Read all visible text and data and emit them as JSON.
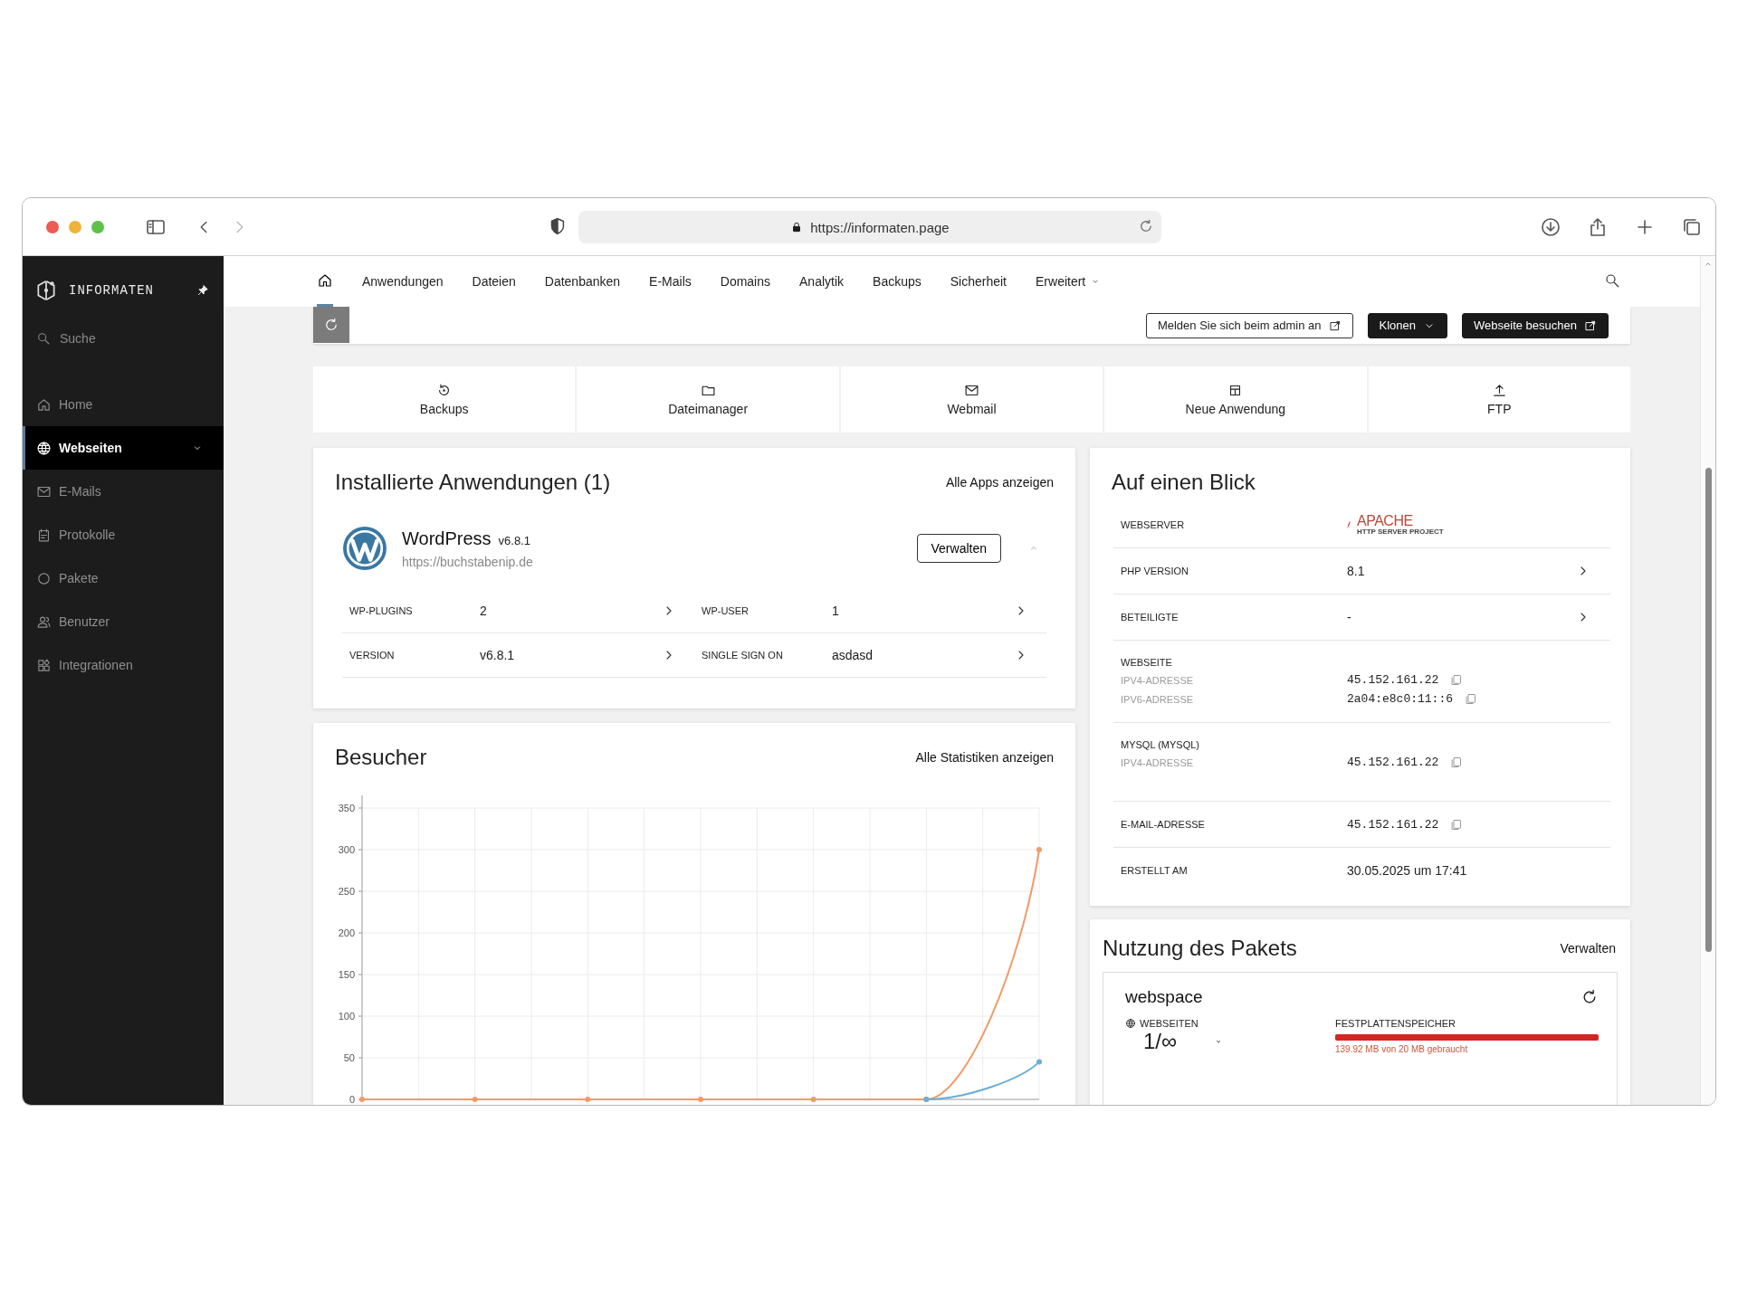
{
  "browser": {
    "url": "https://informaten.page",
    "forward_disabled": true
  },
  "sidebar": {
    "brand": "INFORMATEN",
    "search_placeholder": "Suche",
    "items": [
      {
        "label": "Home",
        "kind": "home",
        "selected": false,
        "expandable": false
      },
      {
        "label": "Webseiten",
        "kind": "globe",
        "selected": true,
        "expandable": true
      },
      {
        "label": "E-Mails",
        "kind": "mail",
        "selected": false,
        "expandable": false
      },
      {
        "label": "Protokolle",
        "kind": "calendar",
        "selected": false,
        "expandable": false
      },
      {
        "label": "Pakete",
        "kind": "circle",
        "selected": false,
        "expandable": false
      },
      {
        "label": "Benutzer",
        "kind": "users",
        "selected": false,
        "expandable": false
      },
      {
        "label": "Integrationen",
        "kind": "grid",
        "selected": false,
        "expandable": false
      }
    ]
  },
  "nav": {
    "items": [
      {
        "kind": "home",
        "selected": true,
        "dropdown": false
      },
      {
        "kind": "text",
        "label": "Anwendungen",
        "selected": false,
        "dropdown": false
      },
      {
        "kind": "text",
        "label": "Dateien",
        "selected": false,
        "dropdown": false
      },
      {
        "kind": "text",
        "label": "Datenbanken",
        "selected": false,
        "dropdown": false
      },
      {
        "kind": "text",
        "label": "E-Mails",
        "selected": false,
        "dropdown": false
      },
      {
        "kind": "text",
        "label": "Domains",
        "selected": false,
        "dropdown": false
      },
      {
        "kind": "text",
        "label": "Analytik",
        "selected": false,
        "dropdown": false
      },
      {
        "kind": "text",
        "label": "Backups",
        "selected": false,
        "dropdown": false
      },
      {
        "kind": "text",
        "label": "Sicherheit",
        "selected": false,
        "dropdown": false
      },
      {
        "kind": "text",
        "label": "Erweitert",
        "selected": false,
        "dropdown": true
      }
    ]
  },
  "actions": [
    {
      "label": "Melden Sie sich beim admin an",
      "kind": "login"
    },
    {
      "label": "Klonen",
      "kind": "clone"
    },
    {
      "label": "Webseite besuchen",
      "kind": "visit"
    }
  ],
  "quick_links": [
    {
      "label": "Backups",
      "kind": "history"
    },
    {
      "label": "Dateimanager",
      "kind": "folder"
    },
    {
      "label": "Webmail",
      "kind": "mail"
    },
    {
      "label": "Neue Anwendung",
      "kind": "app"
    },
    {
      "label": "FTP",
      "kind": "upload"
    }
  ],
  "installed": {
    "title": "Installierte Anwendungen (1)",
    "link": "Alle Apps anzeigen",
    "apps": [
      {
        "name": "WordPress",
        "version": "v6.8.1",
        "url": "https://buchstabenip.de",
        "button": "Verwalten",
        "expanded": true,
        "details": [
          {
            "label": "WP-PLUGINS",
            "value": "2"
          },
          {
            "label": "WP-USER",
            "value": "1"
          },
          {
            "label": "VERSION",
            "value": "v6.8.1"
          },
          {
            "label": "SINGLE SIGN ON",
            "value": "asdasd"
          }
        ]
      }
    ]
  },
  "visitors": {
    "title": "Besucher",
    "link": "Alle Statistiken anzeigen",
    "chart_data": {
      "type": "line",
      "grid": true,
      "ylim": [
        0,
        350
      ],
      "yticks": [
        0,
        50,
        100,
        150,
        200,
        250,
        300,
        350
      ],
      "series": [
        {
          "color": "#f29a68",
          "marker": true,
          "values": [
            0,
            0,
            0,
            0,
            0,
            0,
            300
          ]
        },
        {
          "color": "#6aaed6",
          "marker": true,
          "values": [
            null,
            null,
            null,
            null,
            null,
            0,
            45
          ]
        }
      ]
    }
  },
  "glance": {
    "title": "Auf einen Blick",
    "rows": [
      {
        "kind": "logo",
        "label": "WEBSERVER",
        "value": "APACHE",
        "subtitle": "HTTP SERVER PROJECT"
      },
      {
        "kind": "link",
        "label": "PHP VERSION",
        "value": "8.1"
      },
      {
        "kind": "link",
        "label": "BETEILIGTE",
        "value": "-"
      },
      {
        "kind": "group",
        "label": "WEBSEITE",
        "entries": [
          {
            "label": "IPV4-ADRESSE",
            "value": "45.152.161.22"
          },
          {
            "label": "IPV6-ADRESSE",
            "value": "2a04:e8c0:11::6"
          }
        ]
      },
      {
        "kind": "group",
        "label": "MYSQL (MYSQL)",
        "entries": [
          {
            "label": "IPV4-ADRESSE",
            "value": "45.152.161.22"
          }
        ]
      },
      {
        "kind": "copy",
        "label": "E-MAIL-ADRESSE",
        "value": "45.152.161.22"
      },
      {
        "kind": "plain",
        "label": "ERSTELLT AM",
        "value": "30.05.2025 um 17:41"
      }
    ]
  },
  "usage": {
    "title": "Nutzung des Pakets",
    "link": "Verwalten",
    "package": {
      "name": "webspace",
      "sites_label": "WEBSEITEN",
      "sites_value": "1/∞",
      "storage_label": "FESTPLATTENSPEICHER",
      "level": 1,
      "over": true,
      "storage_text": "139.92 MB von 20 MB gebraucht"
    }
  }
}
